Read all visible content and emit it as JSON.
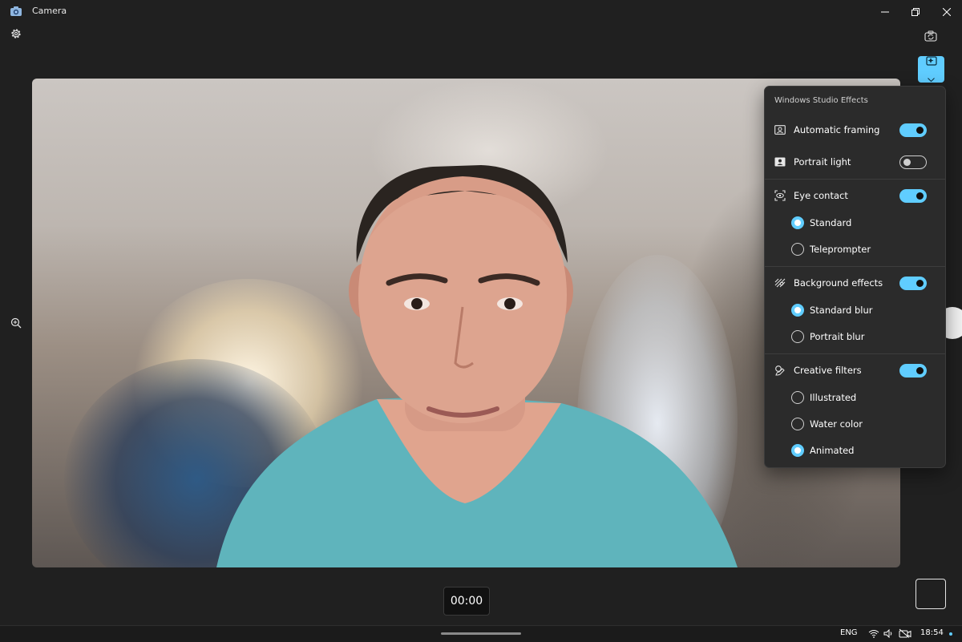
{
  "window": {
    "title": "Camera",
    "icons": {
      "app": "camera-app-icon",
      "minimize": "minimize-icon",
      "maximize": "restore-icon",
      "close": "close-icon"
    }
  },
  "toolbar": {
    "settings_icon": "gear-icon",
    "switch_camera_icon": "switch-camera-icon",
    "effects_icon": "studio-effects-icon",
    "zoom_icon": "zoom-in-icon"
  },
  "recording": {
    "timer": "00:00"
  },
  "effects_panel": {
    "title": "Windows Studio Effects",
    "automatic_framing": {
      "label": "Automatic framing",
      "enabled": true
    },
    "portrait_light": {
      "label": "Portrait light",
      "enabled": false
    },
    "eye_contact": {
      "label": "Eye contact",
      "enabled": true,
      "options": [
        {
          "label": "Standard",
          "selected": true
        },
        {
          "label": "Teleprompter",
          "selected": false
        }
      ]
    },
    "background_effects": {
      "label": "Background effects",
      "enabled": true,
      "options": [
        {
          "label": "Standard blur",
          "selected": true
        },
        {
          "label": "Portrait blur",
          "selected": false
        }
      ]
    },
    "creative_filters": {
      "label": "Creative filters",
      "enabled": true,
      "options": [
        {
          "label": "Illustrated",
          "selected": false
        },
        {
          "label": "Water color",
          "selected": false
        },
        {
          "label": "Animated",
          "selected": true
        }
      ]
    }
  },
  "taskbar": {
    "language": "ENG",
    "time": "18:54"
  },
  "colors": {
    "accent": "#60cdff",
    "background": "#202020",
    "panel": "#2b2b2b"
  }
}
